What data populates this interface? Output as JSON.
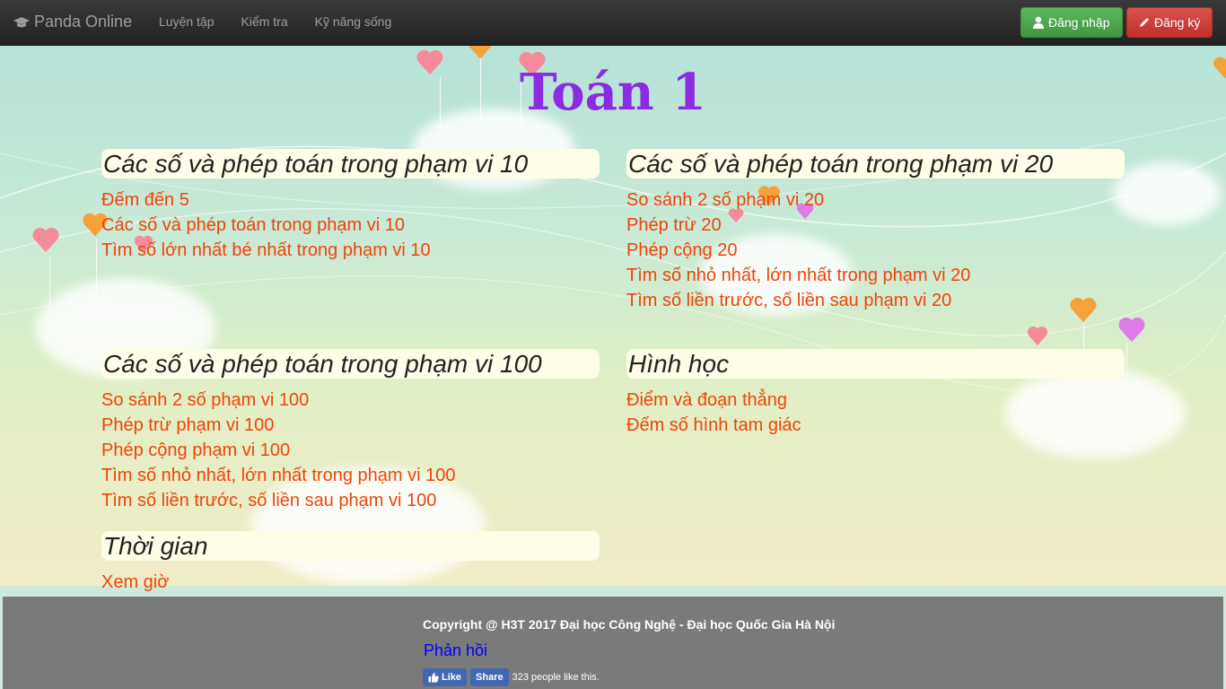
{
  "navbar": {
    "brand": "Panda Online",
    "links": [
      "Luyện tập",
      "Kiểm tra",
      "Kỹ năng sống"
    ],
    "login_label": "Đăng nhập",
    "register_label": "Đăng ký"
  },
  "page_title": "Toán 1",
  "sections": [
    {
      "title": "Các số và phép toán trong phạm vi 10",
      "items": [
        "Đếm đến 5",
        "Các số và phép toán trong phạm vi 10",
        "Tìm số lớn nhất bé nhất trong phạm vi 10"
      ]
    },
    {
      "title": "Các số và phép toán trong phạm vi 20",
      "items": [
        "So sánh 2 số phạm vi 20",
        "Phép trừ 20",
        "Phép cộng 20",
        "Tìm số nhỏ nhất, lớn nhất trong phạm vi 20",
        "Tìm số liền trước, số liền sau phạm vi 20"
      ]
    },
    {
      "title": "Các số và phép toán trong phạm vi 100",
      "items": [
        "So sánh 2 số phạm vi 100",
        "Phép trừ phạm vi 100",
        "Phép cộng phạm vi 100",
        "Tìm số nhỏ nhất, lớn nhất trong phạm vi 100",
        "Tìm số liền trước, số liền sau phạm vi 100"
      ]
    },
    {
      "title": "Hình học",
      "items": [
        "Điểm và đoạn thẳng",
        "Đếm số hình tam giác"
      ]
    },
    {
      "title": "Thời gian",
      "items": [
        "Xem giờ"
      ]
    }
  ],
  "footer": {
    "copyright": "Copyright @ H3T 2017 Đại học Công Nghệ - Đại học Quốc Gia Hà Nội",
    "feedback": "Phản hồi",
    "like_label": "Like",
    "share_label": "Share",
    "like_count_text": "323 people like this."
  },
  "colors": {
    "title": "#8b2be2",
    "link": "#f0440a",
    "login": "#5cb85c",
    "register": "#d9534f"
  }
}
